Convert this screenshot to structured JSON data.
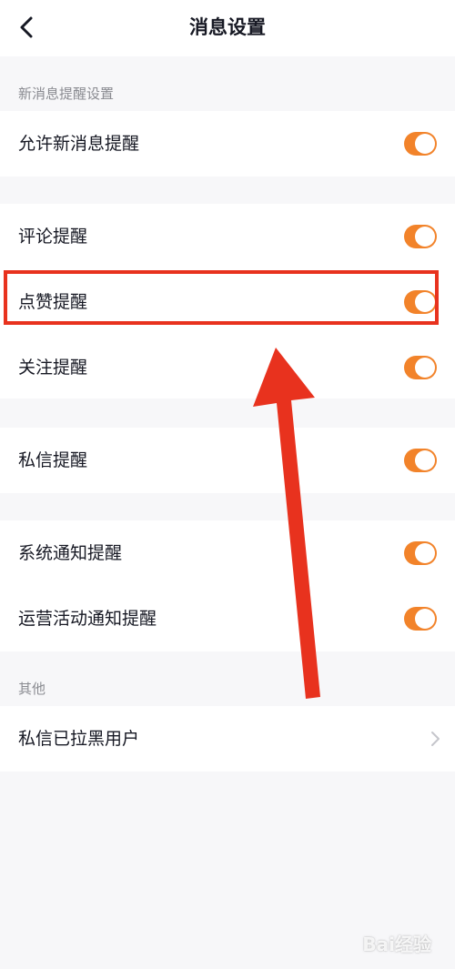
{
  "header": {
    "title": "消息设置",
    "back_icon": "chevron-left-icon"
  },
  "sections": {
    "new_message_label": "新消息提醒设置",
    "other_label": "其他"
  },
  "items": {
    "allow_new": {
      "label": "允许新消息提醒",
      "on": true
    },
    "comment": {
      "label": "评论提醒",
      "on": true
    },
    "like": {
      "label": "点赞提醒",
      "on": true
    },
    "follow": {
      "label": "关注提醒",
      "on": true
    },
    "private_msg": {
      "label": "私信提醒",
      "on": true
    },
    "system": {
      "label": "系统通知提醒",
      "on": true
    },
    "operations": {
      "label": "运营活动通知提醒",
      "on": true
    },
    "blocked": {
      "label": "私信已拉黑用户"
    }
  },
  "colors": {
    "toggle_on": "#f2832a",
    "annotation": "#e8321e"
  },
  "watermark": "Bai经验"
}
